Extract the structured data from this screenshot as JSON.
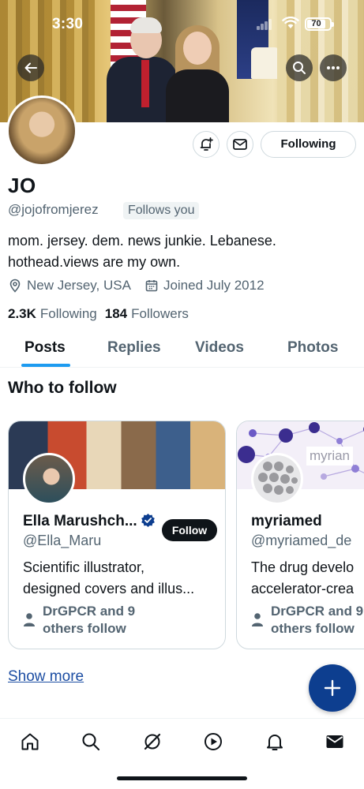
{
  "status_bar": {
    "time": "3:30",
    "battery": "70"
  },
  "profile": {
    "name": "JO",
    "handle": "@jojofromjerez",
    "follows_you": "Follows you",
    "bio_line1": "mom. jersey. dem. news junkie. Lebanese.",
    "bio_line2": "hothead.views are my own.",
    "location": "New Jersey, USA",
    "joined": "Joined July 2012",
    "following_count": "2.3K",
    "following_label": "Following",
    "followers_count": "184",
    "followers_label": "Followers",
    "following_button": "Following"
  },
  "tabs": [
    {
      "label": "Posts",
      "active": true
    },
    {
      "label": "Replies",
      "active": false
    },
    {
      "label": "Videos",
      "active": false
    },
    {
      "label": "Photos",
      "active": false
    }
  ],
  "who_to_follow": {
    "title": "Who to follow",
    "cards": [
      {
        "name": "Ella Marushch...",
        "handle": "@Ella_Maru",
        "bio_line1": "Scientific illustrator,",
        "bio_line2": "designed covers and illus...",
        "social_line1": "DrGPCR and 9",
        "social_line2": "others follow",
        "follow_label": "Follow",
        "verified": true
      },
      {
        "name": "myriamed",
        "handle": "@myriamed_de",
        "bio_line1": "The drug develo",
        "bio_line2": "accelerator-crea",
        "social_line1": "DrGPCR and 9",
        "social_line2": "others follow",
        "cover_logo": "myrian",
        "verified": false
      }
    ],
    "show_more": "Show more"
  },
  "colors": {
    "accent": "#1d9bf0",
    "fab": "#0d3e8f",
    "verified": "#0d3e8f",
    "text_secondary": "#536471"
  },
  "icons": {
    "nav": [
      "home-icon",
      "search-icon",
      "grok-icon",
      "video-icon",
      "bell-icon",
      "mail-icon"
    ]
  }
}
